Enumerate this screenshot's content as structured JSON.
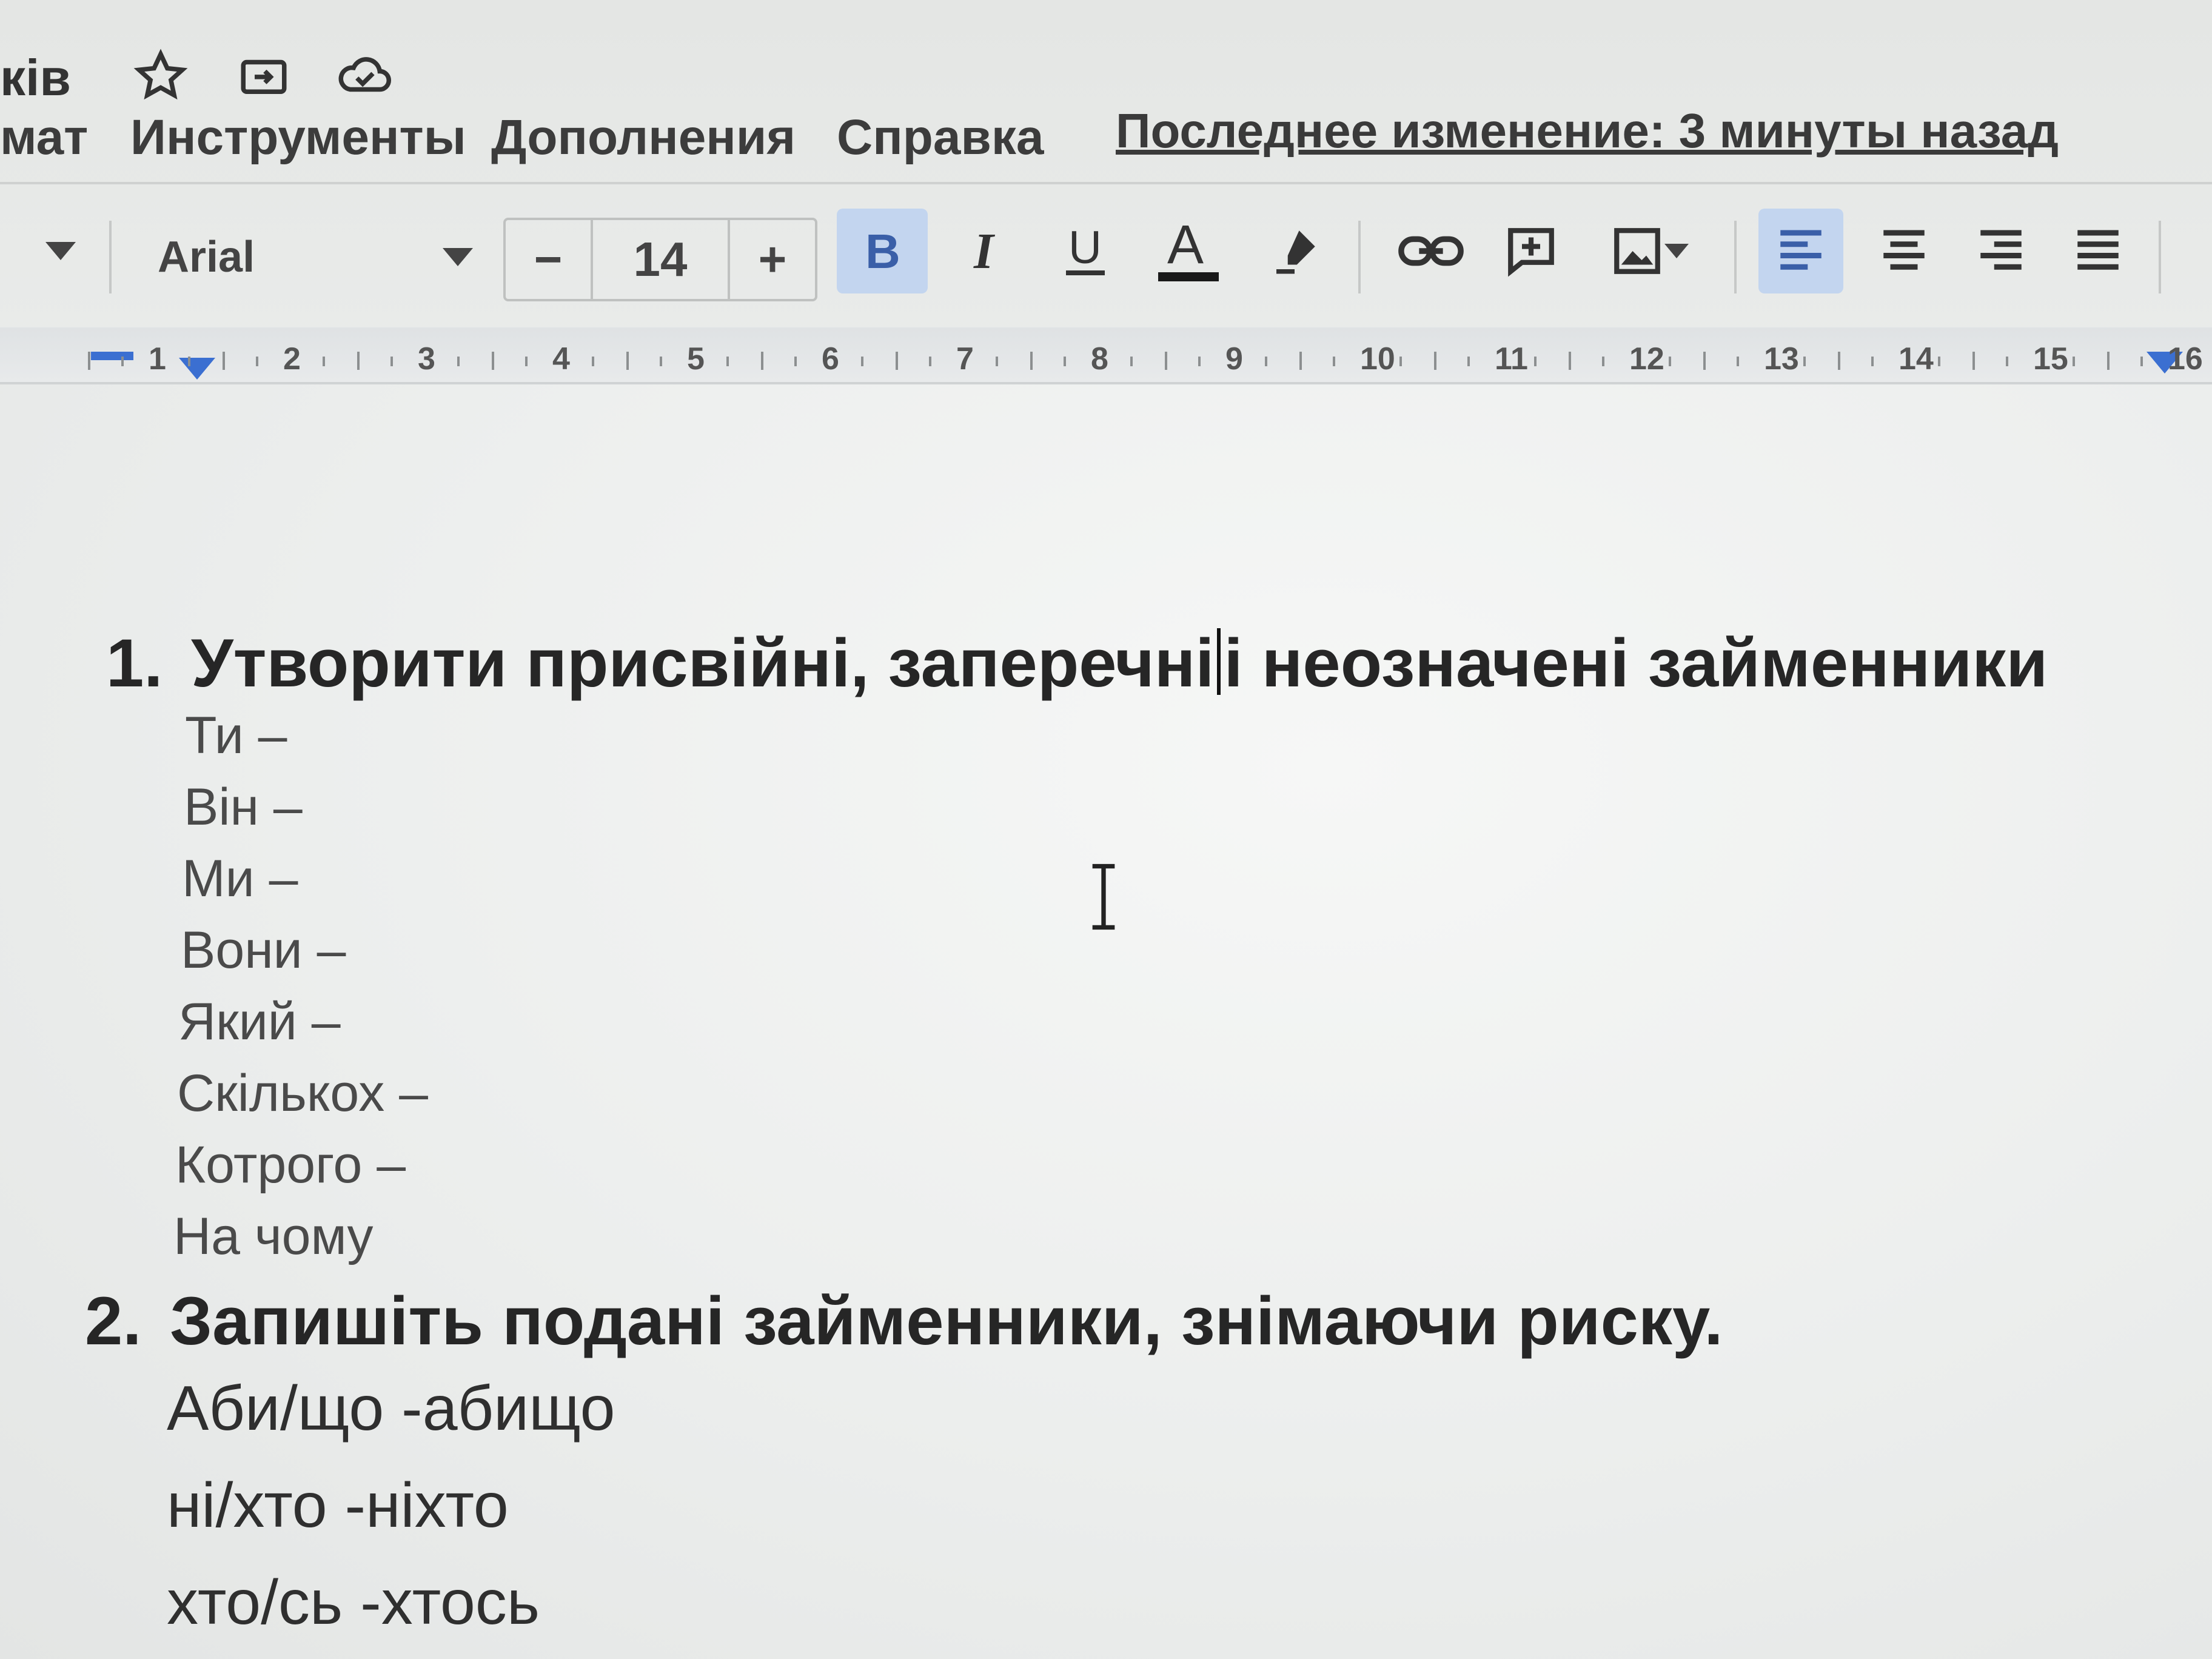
{
  "title_bar": {
    "doc_title_fragment": "ків",
    "icons": [
      "star-icon",
      "move-to-folder-icon",
      "cloud-saved-icon"
    ]
  },
  "menu": {
    "items": [
      "мат",
      "Инструменты",
      "Дополнения",
      "Справка"
    ],
    "last_edit": "Последнее изменение: 3 минуты назад"
  },
  "toolbar": {
    "font_name": "Arial",
    "font_size": "14",
    "minus": "−",
    "plus": "+",
    "bold_active": true,
    "align_left_active": true
  },
  "ruler": {
    "numbers": [
      "1",
      "2",
      "3",
      "4",
      "5",
      "6",
      "7",
      "8",
      "9",
      "10",
      "11",
      "12",
      "13",
      "14",
      "15",
      "16"
    ]
  },
  "document": {
    "section1": {
      "number": "1.",
      "title_before_caret": "Утворити присвійні, заперечні",
      "title_after_caret": "і неозначені займенники",
      "lines": [
        "Ти –",
        "Він –",
        "Ми –",
        "Вони –",
        "Який –",
        "Скількох –",
        "Котрого –",
        "На чому"
      ]
    },
    "section2": {
      "number": "2.",
      "title": "Запишіть подані займенники, знімаючи риску.",
      "lines": [
        "Аби/що -абищо",
        "ні/хто -ніхто",
        "хто/сь -хтось"
      ]
    }
  },
  "colors": {
    "active_button_bg": "#c3d5ef",
    "text_color_bar": "#1a1a1a"
  }
}
